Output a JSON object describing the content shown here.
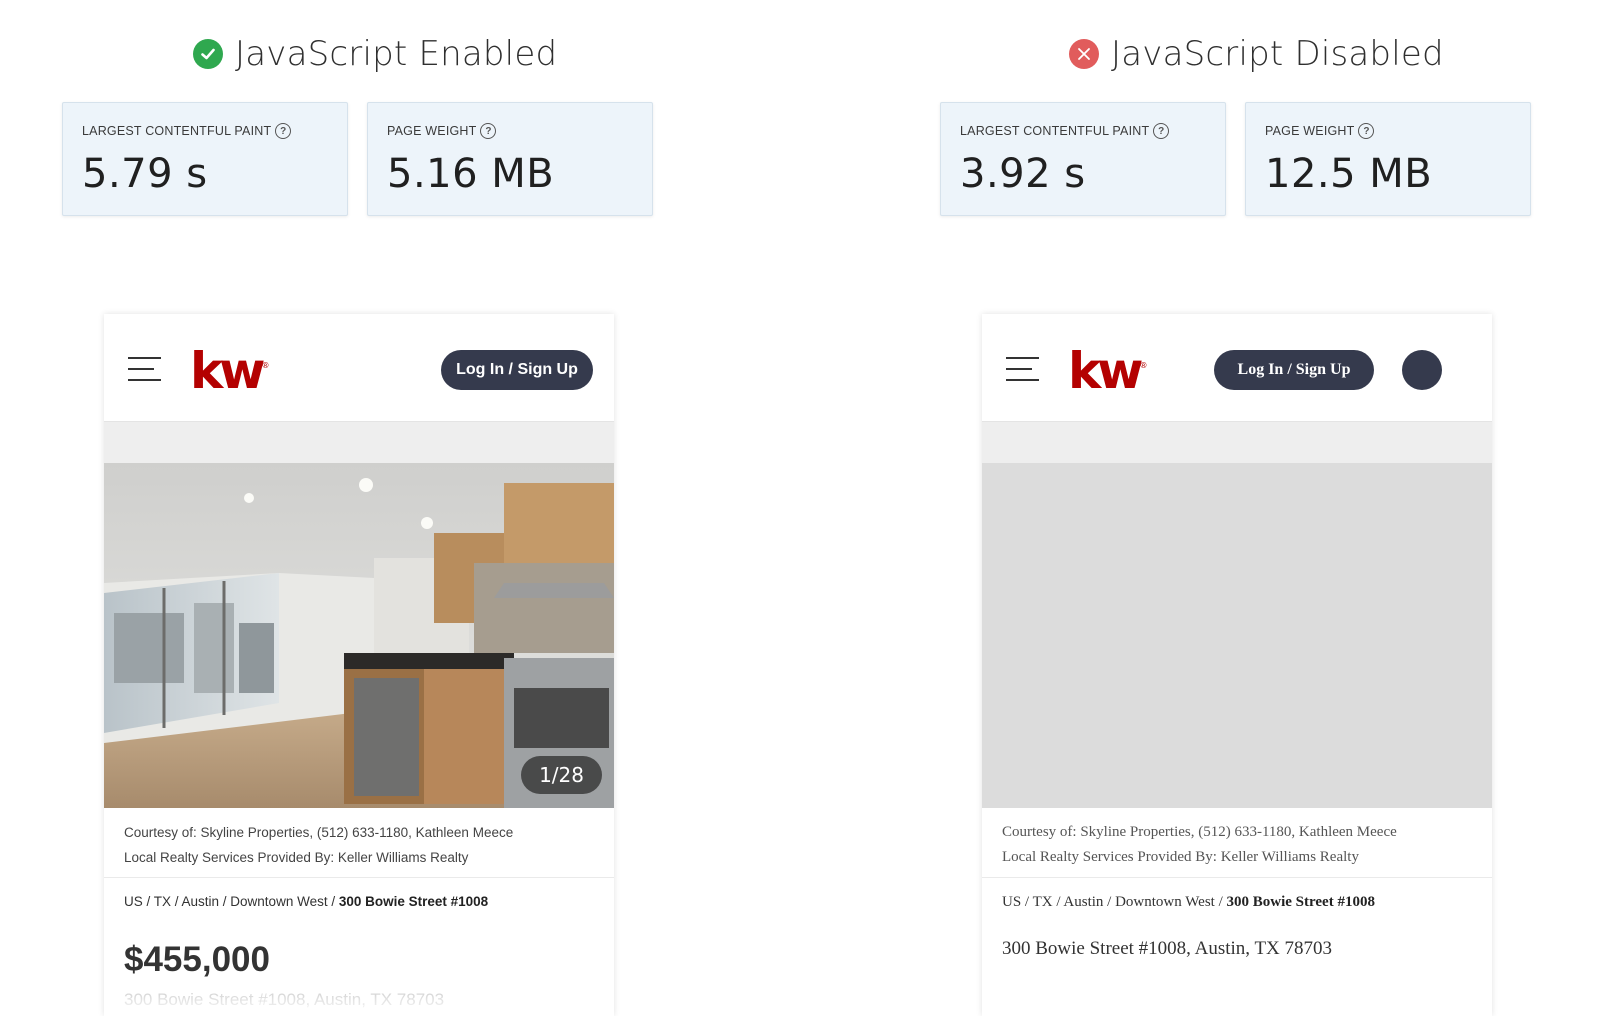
{
  "enabled": {
    "title": "JavaScript Enabled",
    "status_icon": "check-circle-icon",
    "status_color": "#2fa84f",
    "metrics": {
      "lcp_label": "LARGEST CONTENTFUL PAINT",
      "lcp_value": "5.79 s",
      "weight_label": "PAGE WEIGHT",
      "weight_value": "5.16 MB"
    },
    "phone": {
      "logo": "kw",
      "logo_mark": "®",
      "login_label": "Log In / Sign Up",
      "photo_counter": "1/28",
      "courtesy_line1": "Courtesy of: Skyline Properties, (512) 633-1180, Kathleen Meece",
      "courtesy_line2": "Local Realty Services Provided By: Keller Williams Realty",
      "breadcrumb_path": "US / TX / Austin / Downtown West / ",
      "breadcrumb_current": "300 Bowie Street #1008",
      "price": "$455,000",
      "address": "300 Bowie Street #1008, Austin, TX 78703"
    }
  },
  "disabled": {
    "title": "JavaScript Disabled",
    "status_icon": "x-circle-icon",
    "status_color": "#e15c5c",
    "metrics": {
      "lcp_label": "LARGEST CONTENTFUL PAINT",
      "lcp_value": "3.92 s",
      "weight_label": "PAGE WEIGHT",
      "weight_value": "12.5 MB"
    },
    "phone": {
      "logo": "kw",
      "logo_mark": "®",
      "login_label": "Log In / Sign Up",
      "courtesy_line1": "Courtesy of: Skyline Properties, (512) 633-1180, Kathleen Meece",
      "courtesy_line2": "Local Realty Services Provided By: Keller Williams Realty",
      "breadcrumb_path": "US / TX / Austin / Downtown West / ",
      "breadcrumb_current": "300 Bowie Street #1008",
      "address": "300 Bowie Street #1008, Austin, TX 78703"
    }
  },
  "colors": {
    "brand_red": "#b40101",
    "button_dark": "#353a4d",
    "metric_bg": "#edf4fa"
  }
}
